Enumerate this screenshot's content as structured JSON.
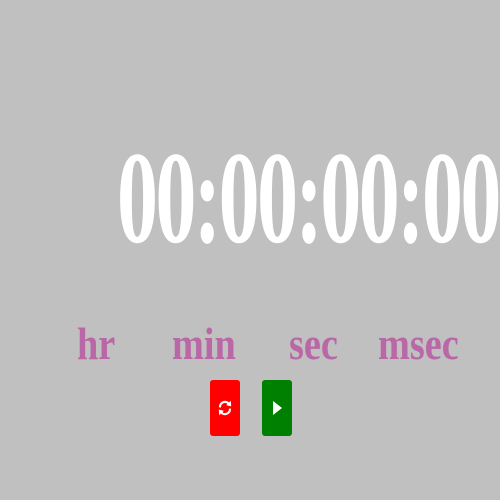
{
  "display": {
    "time": "00:00:00:00"
  },
  "labels": {
    "hr": "hr",
    "min": "min",
    "sec": "sec",
    "msec": "msec"
  },
  "controls": {
    "reset_icon": "refresh-icon",
    "play_icon": "play-icon"
  },
  "colors": {
    "background": "#c0c0c0",
    "digits": "#ffffff",
    "labels": "#b967a7",
    "reset_button": "#ff0000",
    "play_button": "#008000"
  }
}
